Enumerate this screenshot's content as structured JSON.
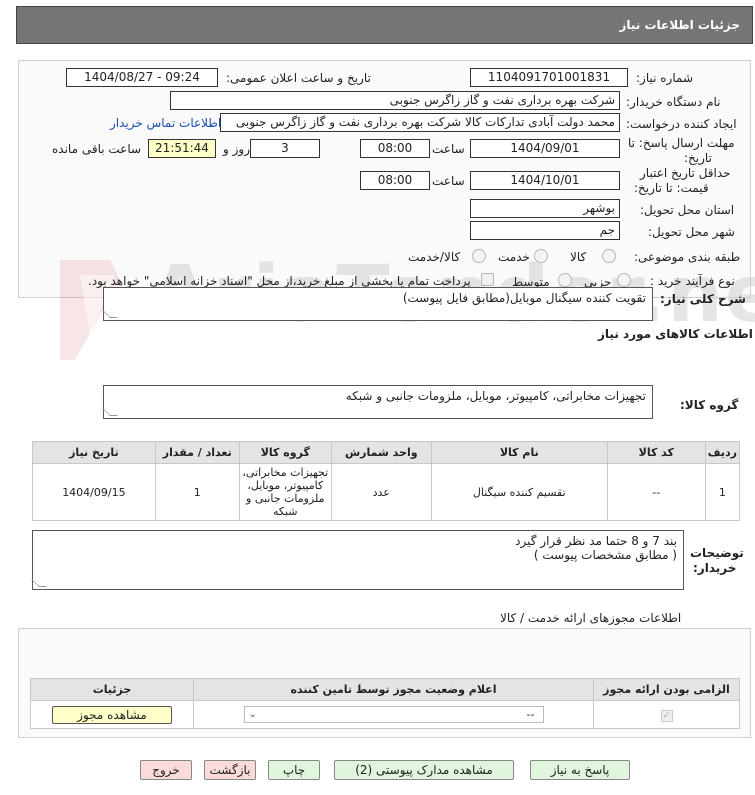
{
  "header": {
    "title": "جزئیات اطلاعات نیاز"
  },
  "form": {
    "need_number_label": "شماره نیاز:",
    "need_number": "1104091701001831",
    "announce_label": "تاریخ و ساعت اعلان عمومی:",
    "announce_value": "1404/08/27 - 09:24",
    "buyer_org_label": "نام دستگاه خریدار:",
    "buyer_org": "شرکت بهره برداری نفت و گاز زاگرس جنوبی",
    "creator_label": "ایجاد کننده درخواست:",
    "creator": "محمد دولت آبادی تدارکات کالا شرکت بهره برداری نفت و گاز زاگرس جنوبی",
    "contact_link": "اطلاعات تماس خریدار",
    "deadline_label_1": "مهلت ارسال پاسخ: تا",
    "deadline_label_2": "تاریخ:",
    "deadline_date": "1404/09/01",
    "time_label": "ساعت",
    "deadline_time": "08:00",
    "days_value": "3",
    "days_label": "روز و",
    "remaining_time": "21:51:44",
    "remaining_label": "ساعت باقی مانده",
    "validity_label_1": "حداقل تاریخ اعتبار",
    "validity_label_2": "قیمت: تا تاریخ:",
    "validity_date": "1404/10/01",
    "validity_time": "08:00",
    "province_label": "استان محل تحویل:",
    "province": "بوشهر",
    "city_label": "شهر محل تحویل:",
    "city": "جم",
    "category_label": "طبقه بندی موضوعی:",
    "category_options": [
      "کالا",
      "خدمت",
      "کالا/خدمت"
    ],
    "process_label": "نوع فرآیند خرید :",
    "process_options": [
      "جزیی",
      "متوسط"
    ],
    "payment_text": "پرداخت تمام یا بخشی از مبلغ خرید،از محل \"اسناد خزانه اسلامی\" خواهد بود."
  },
  "description": {
    "label": "شرح کلی نیاز:",
    "value": "تقویت کننده سیگنال موبایل(مطابق فایل پیوست)"
  },
  "goods": {
    "section_title": "اطلاعات کالاهای مورد نیاز",
    "group_label": "گروه کالا:",
    "group_value": "تجهیزات مخابراتی، کامپیوتر، موبایل، ملزومات جانبی و شبکه",
    "columns": [
      "ردیف",
      "کد کالا",
      "نام کالا",
      "واحد شمارش",
      "گروه کالا",
      "تعداد / مقدار",
      "تاریخ نیاز"
    ],
    "rows": [
      {
        "row": "1",
        "code": "--",
        "name": "تقسیم کننده سیگنال",
        "unit": "عدد",
        "group": "تجهیزات مخابراتی، کامپیوتر، موبایل، ملزومات جانبی و شبکه",
        "qty": "1",
        "date": "1404/09/15"
      }
    ]
  },
  "buyer_notes": {
    "label_1": "توضیحات",
    "label_2": "خریدار:",
    "line_1": "بند  7   و 8  حتما مد نظر قرار گیرد",
    "line_2": "( مطابق مشخصات پیوست )"
  },
  "permits": {
    "section_title": "اطلاعات مجوزهای ارائه خدمت / کالا",
    "col_required": "الزامی بودن ارائه مجوز",
    "col_status": "اعلام وضعیت مجوز توسط تامین کننده",
    "col_details": "جزئیات",
    "status_value": "--",
    "view_button": "مشاهده مجوز"
  },
  "footer_buttons": {
    "reply": "پاسخ به نیاز",
    "attachments": "مشاهده مدارک پیوستی (2)",
    "print": "چاپ",
    "back": "بازگشت",
    "exit": "خروج"
  },
  "watermark": {
    "text": "AriaTender.net"
  },
  "colors": {
    "header_bg": "#757575",
    "link": "#1a4fb4",
    "highlight": "#ffffc8",
    "green_btn": "#dff5dc",
    "pink_btn": "#fadada"
  }
}
